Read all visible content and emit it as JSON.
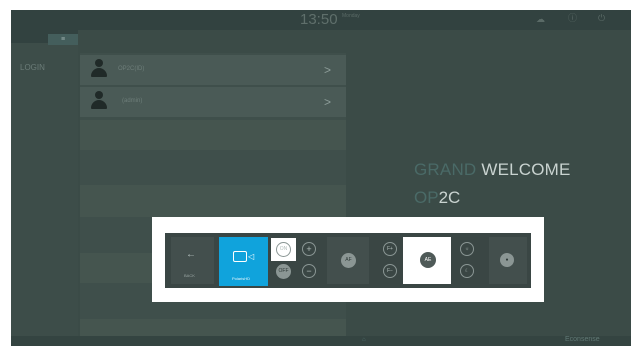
{
  "header": {
    "clock": "13:50",
    "clock_sub": "Monday",
    "icons": [
      "cloud-icon",
      "info-icon",
      "power-icon"
    ]
  },
  "nav": {
    "tab_label": "≡",
    "login_label": "LOGIN"
  },
  "users": [
    {
      "name": "OP2C(ID)"
    },
    {
      "name": "(admin)"
    }
  ],
  "welcome": {
    "line1_highlight": "GRAND",
    "line1_rest": "WELCOME",
    "line2_highlight": "OP",
    "line2_rest": "2C"
  },
  "footer": {
    "brand": "Econsense"
  },
  "toolbar": {
    "back_label": "BACK",
    "video_label": "PolarisHD",
    "on_label": "ON",
    "off_label": "OFF",
    "plus": "+",
    "minus": "−",
    "af_label": "AF",
    "ae_label": "AE",
    "ae_plus": "F+",
    "ae_minus": "F−",
    "accent_color": "#10a3dc"
  }
}
